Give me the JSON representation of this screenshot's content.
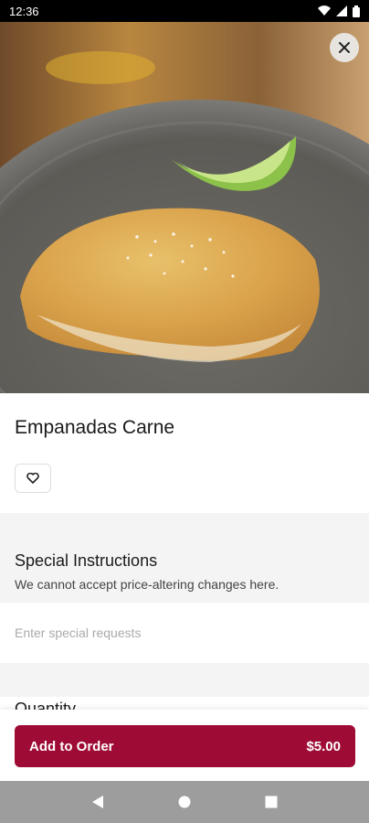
{
  "status": {
    "time": "12:36"
  },
  "item": {
    "title": "Empanadas Carne"
  },
  "special": {
    "title": "Special Instructions",
    "subtitle": "We cannot accept price-altering changes here.",
    "placeholder": "Enter special requests"
  },
  "quantity": {
    "label": "Quantity"
  },
  "order": {
    "label": "Add to Order",
    "price": "$5.00"
  },
  "colors": {
    "accent": "#9e0b34"
  }
}
